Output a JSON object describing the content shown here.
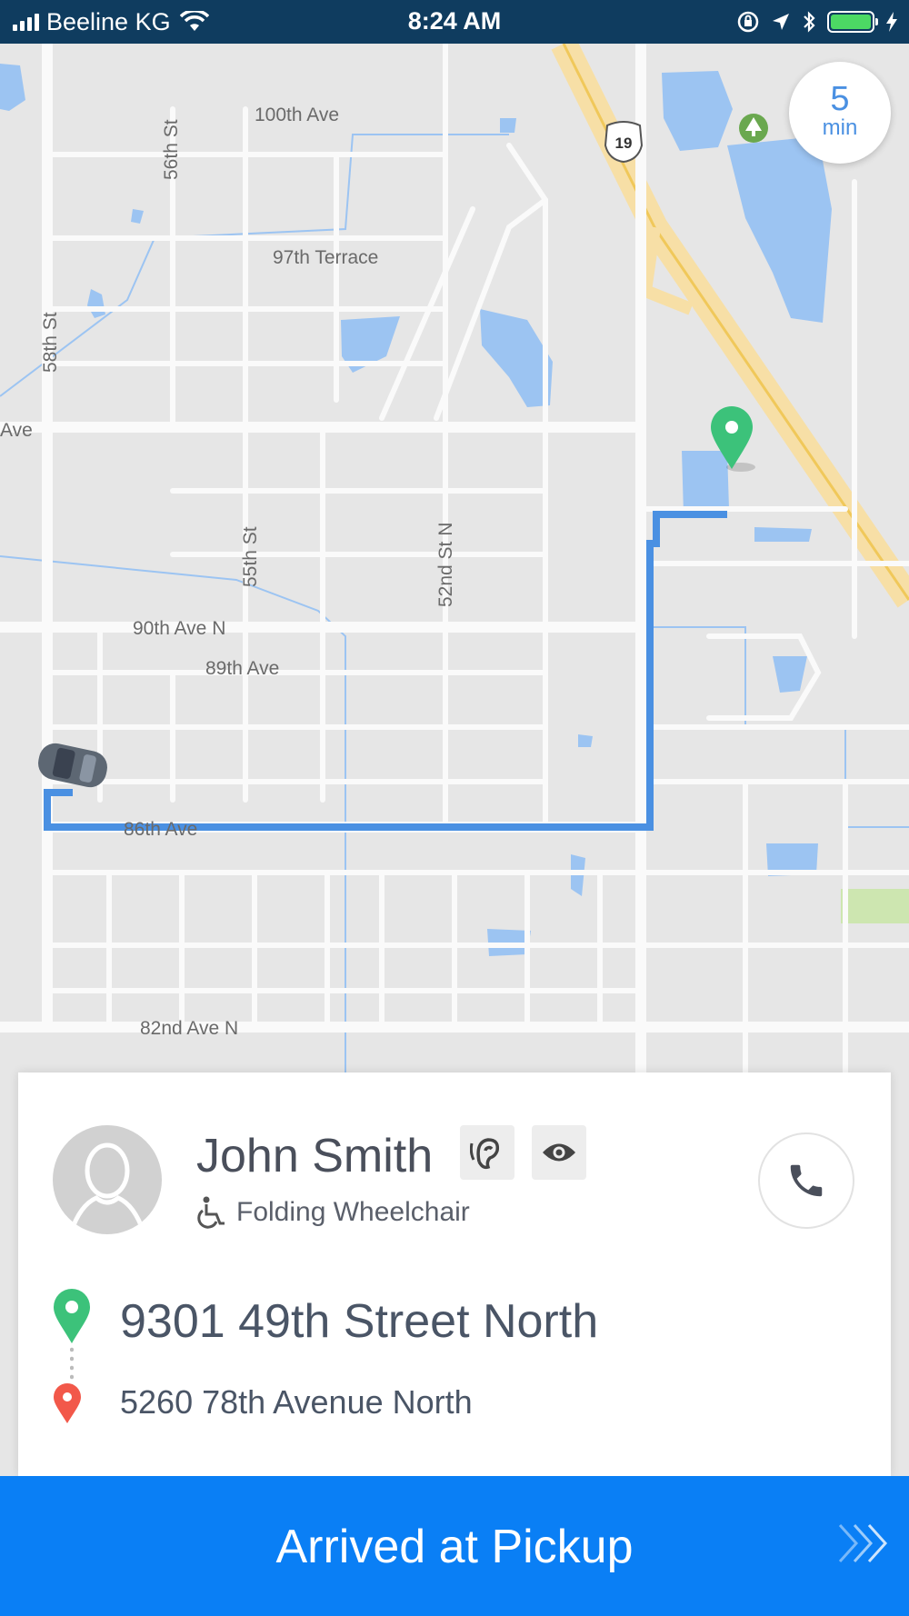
{
  "status_bar": {
    "carrier": "Beeline KG",
    "time": "8:24 AM",
    "battery_level": 1.0
  },
  "map": {
    "street_labels": [
      "100th Ave",
      "97th Terrace",
      "58th St",
      "56th St",
      "55th St",
      "52nd St N",
      "90th Ave N",
      "89th Ave",
      "86th Ave",
      "82nd Ave N",
      "Ave",
      "19"
    ],
    "eta": {
      "value": "5",
      "unit": "min"
    }
  },
  "rider": {
    "name": "John Smith",
    "needs": "Folding Wheelchair",
    "icons": [
      "hearing-icon",
      "vision-icon",
      "wheelchair-icon",
      "phone-icon"
    ]
  },
  "trip": {
    "pickup_address": "9301 49th Street North",
    "dropoff_address": "5260 78th Avenue North"
  },
  "action": {
    "label": "Arrived at Pickup"
  },
  "colors": {
    "status_bar": "#0f3c5f",
    "route": "#4a90e2",
    "pickup_pin": "#3cc27a",
    "dropoff_pin": "#f2584a",
    "primary_button": "#0a7ff5",
    "map_bg": "#e6e6e6",
    "water": "#9cc4f2"
  }
}
